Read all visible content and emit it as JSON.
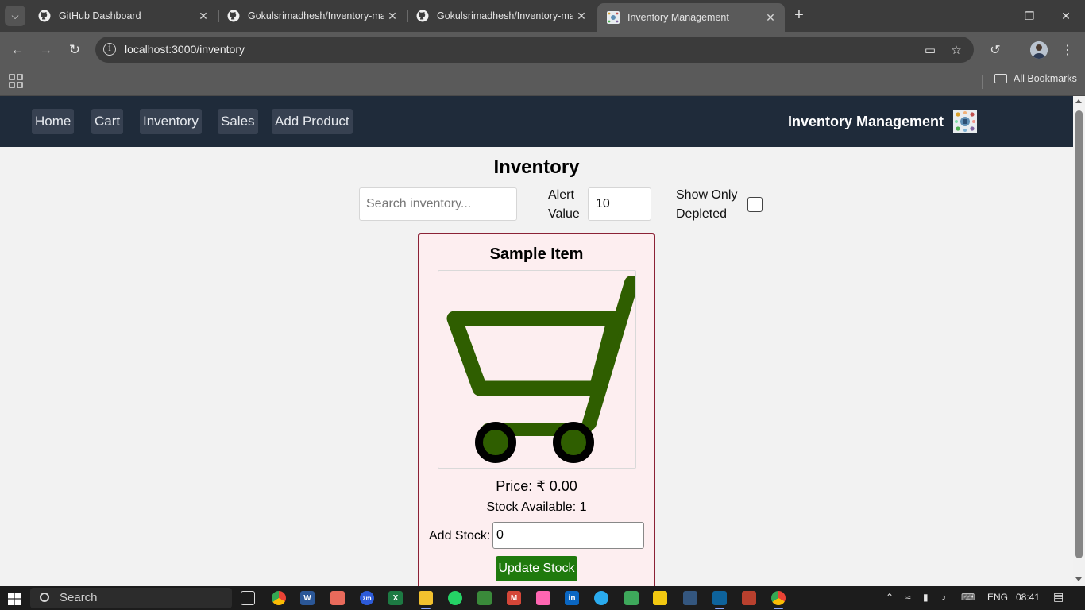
{
  "browser": {
    "tabs": [
      {
        "title": "GitHub Dashboard",
        "icon": "github-icon",
        "active": false
      },
      {
        "title": "Gokulsrimadhesh/Inventory-ma",
        "icon": "github-icon",
        "active": false
      },
      {
        "title": "Gokulsrimadhesh/Inventory-ma",
        "icon": "github-icon",
        "active": false
      },
      {
        "title": "Inventory Management",
        "icon": "site-logo-icon",
        "active": true
      }
    ],
    "url": "localhost:3000/inventory",
    "all_bookmarks": "All Bookmarks"
  },
  "navbar": {
    "links": [
      "Home",
      "Cart",
      "Inventory",
      "Sales",
      "Add Product"
    ],
    "brand": "Inventory Management"
  },
  "main": {
    "heading": "Inventory",
    "search_placeholder": "Search inventory...",
    "alert_label": "Alert Value",
    "alert_value": "10",
    "depleted_label": "Show Only Depleted",
    "depleted_checked": false
  },
  "card": {
    "title": "Sample Item",
    "image": "shopping-cart-icon",
    "price": "Price: ₹ 0.00",
    "stock": "Stock Available: 1",
    "add_stock_label": "Add Stock:",
    "add_stock_value": "0",
    "update_button": "Update Stock"
  },
  "colors": {
    "navbar_bg": "#1f2b3a",
    "card_bg": "#fdeef0",
    "card_border": "#8b2236",
    "update_button_bg": "#1f7a0d",
    "cart_green": "#2f5e00"
  },
  "taskbar": {
    "search": "Search",
    "language": "ENG",
    "time": "08:41"
  }
}
